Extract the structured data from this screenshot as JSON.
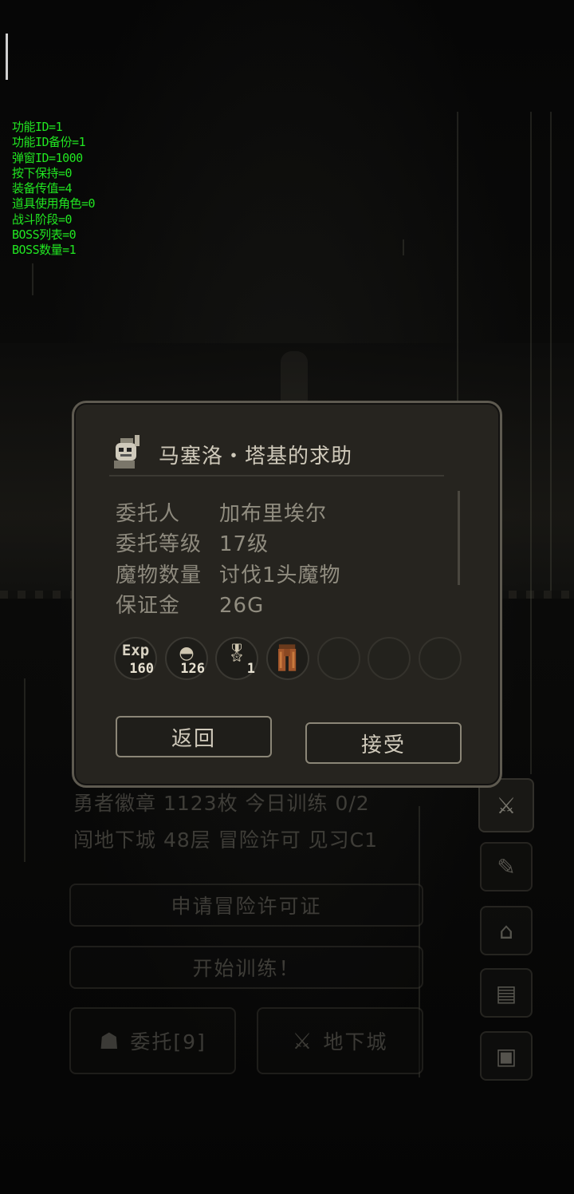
{
  "debug_lines": [
    "功能ID=1",
    "功能ID备份=1",
    "弹窗ID=1000",
    "按下保持=0",
    "装备传值=4",
    "道具使用角色=0",
    "战斗阶段=0",
    "BOSS列表=0",
    "BOSS数量=1"
  ],
  "background": {
    "line1": "勇者徽章 1123枚 今日训练 0/2",
    "line2": "闯地下城 48层    冒险许可 见习C1",
    "apply_label": "申请冒险许可证",
    "train_label": "开始训练！",
    "commission_label": "委托[9]",
    "dungeon_label": "地下城"
  },
  "dialog": {
    "title": "马塞洛・塔基的求助",
    "rows": [
      {
        "key": "委托人",
        "value": "加布里埃尔"
      },
      {
        "key": "委托等级",
        "value": "17级"
      },
      {
        "key": "魔物数量",
        "value": "讨伐1头魔物"
      },
      {
        "key": "保证金",
        "value": "26G"
      }
    ],
    "rewards": [
      {
        "label": "Exp",
        "count": "160",
        "icon": "exp-icon"
      },
      {
        "label": "",
        "count": "126",
        "icon": "coins-icon"
      },
      {
        "label": "",
        "count": "1",
        "icon": "medal-icon"
      },
      {
        "label": "",
        "count": "",
        "icon": "leather-pants-icon"
      }
    ],
    "return_label": "返回",
    "accept_label": "接受"
  },
  "colors": {
    "debug_text": "#21e621",
    "dialog_bg": "#26241f",
    "dialog_border": "#5e5a50"
  }
}
